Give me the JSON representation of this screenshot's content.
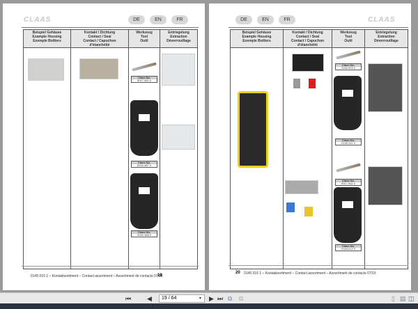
{
  "brand": "CLAAS",
  "languages": [
    "DE",
    "EN",
    "FR"
  ],
  "headers": [
    "Beispiel Gehäuse\nExample Housing\nExemple Boîtiers",
    "Kontakt / Dichtung\nContact / Seal\nContact / Capuchon\nd'étanchéité",
    "Werkzeug\nTool\nOutil",
    "Entriegelung\nExtraction\nDéverrouillage"
  ],
  "class_label": "Class No.",
  "left": {
    "class_nos": [
      "0017 062 0",
      "0016 487 0",
      "0016 488 0"
    ],
    "page_number": "19"
  },
  "right": {
    "class_nos": [
      "0145 003 0",
      "0145 011 0",
      "0017 062 0",
      "0145 012 0"
    ],
    "page_number": "20"
  },
  "footer_text": "0145 016 1 – Kontaktsortiment – Contact assortment – Assortiment de contacts 07/15",
  "toolbar": {
    "page_value": "19 / 64"
  },
  "colors": {
    "background": "#9a9a9a",
    "header_fill": "#e6e6e6"
  }
}
